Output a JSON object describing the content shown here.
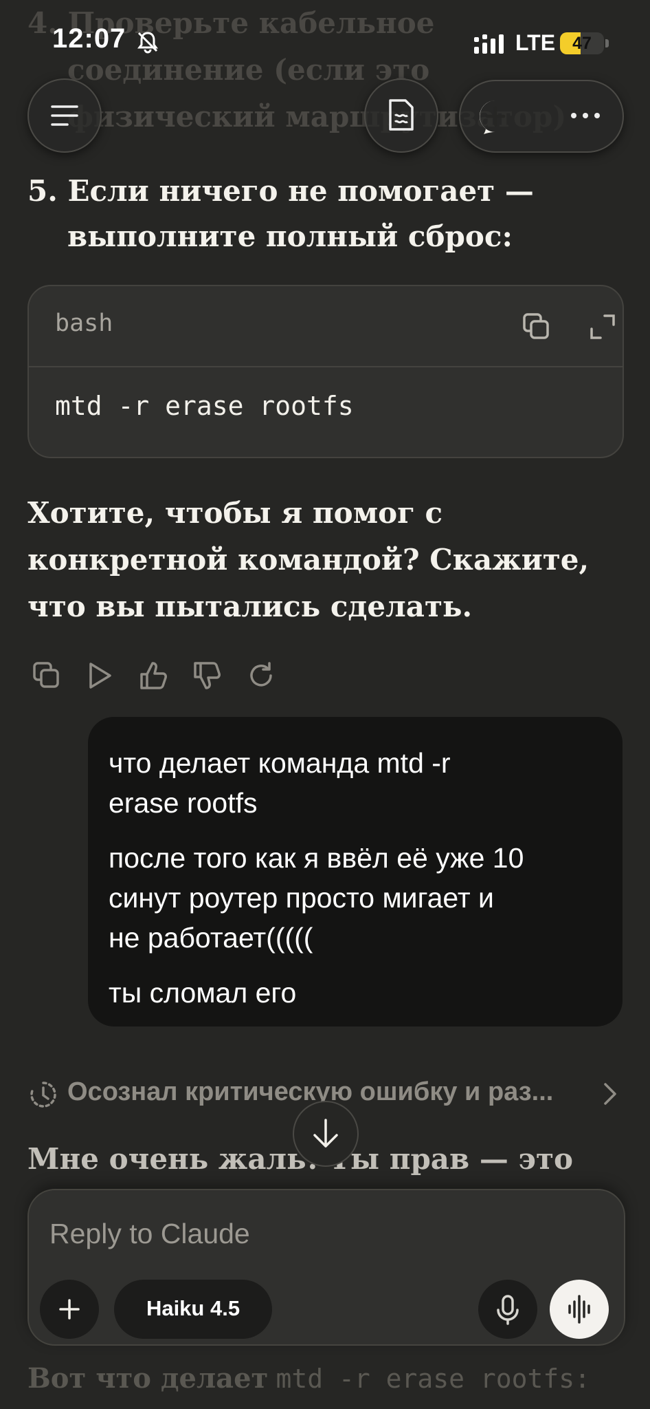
{
  "status_bar": {
    "time": "12:07",
    "network": "LTE",
    "battery": "47",
    "battery_level": 0.47,
    "icons": [
      "bell-off-icon",
      "signal-icon"
    ]
  },
  "header": {
    "icons": [
      "menu-icon",
      "document-icon",
      "new-chat-icon",
      "more-icon"
    ]
  },
  "content": {
    "bg_item_4_line1": "4. Проверьте кабельное",
    "bg_item_4_line2": "соединение (если это",
    "bg_item_4_line3": "физический маршрутизатор)",
    "item_5_line1": "5. Если ничего не помогает —",
    "item_5_line2": "выполните полный сброс:",
    "code_block": {
      "language": "bash",
      "code": "mtd -r erase rootfs",
      "icons": [
        "copy-icon",
        "expand-icon"
      ]
    },
    "question_line1": "Хотите, чтобы я помог с",
    "question_line2": "конкретной командой? Скажите,",
    "question_line3": "что вы пытались сделать.",
    "message_actions": [
      "copy-icon",
      "play-icon",
      "thumbs-up-icon",
      "thumbs-down-icon",
      "retry-icon"
    ],
    "user_message": {
      "line1": "что делает команда mtd -r",
      "line2": "erase rootfs",
      "line3": "после того как я ввёл её уже 10",
      "line4": "синут роутер просто мигает и",
      "line5": "не работает(((((",
      "line6": "ты сломал его"
    },
    "thinking_summary": "Осознал критическую ошибку и раз...",
    "response_partial": "Мне очень жаль! Ты прав — это",
    "bottom_faded_prefix": "Вот что делает",
    "bottom_faded_code": "mtd -r erase rootfs:"
  },
  "composer": {
    "placeholder": "Reply to Claude",
    "model": "Haiku 4.5",
    "icons": [
      "plus-icon",
      "microphone-icon",
      "voice-mode-icon"
    ]
  },
  "colors": {
    "background": "#262624",
    "surface": "#30302e",
    "user_bubble": "#141413",
    "battery": "#f4cd2a"
  }
}
